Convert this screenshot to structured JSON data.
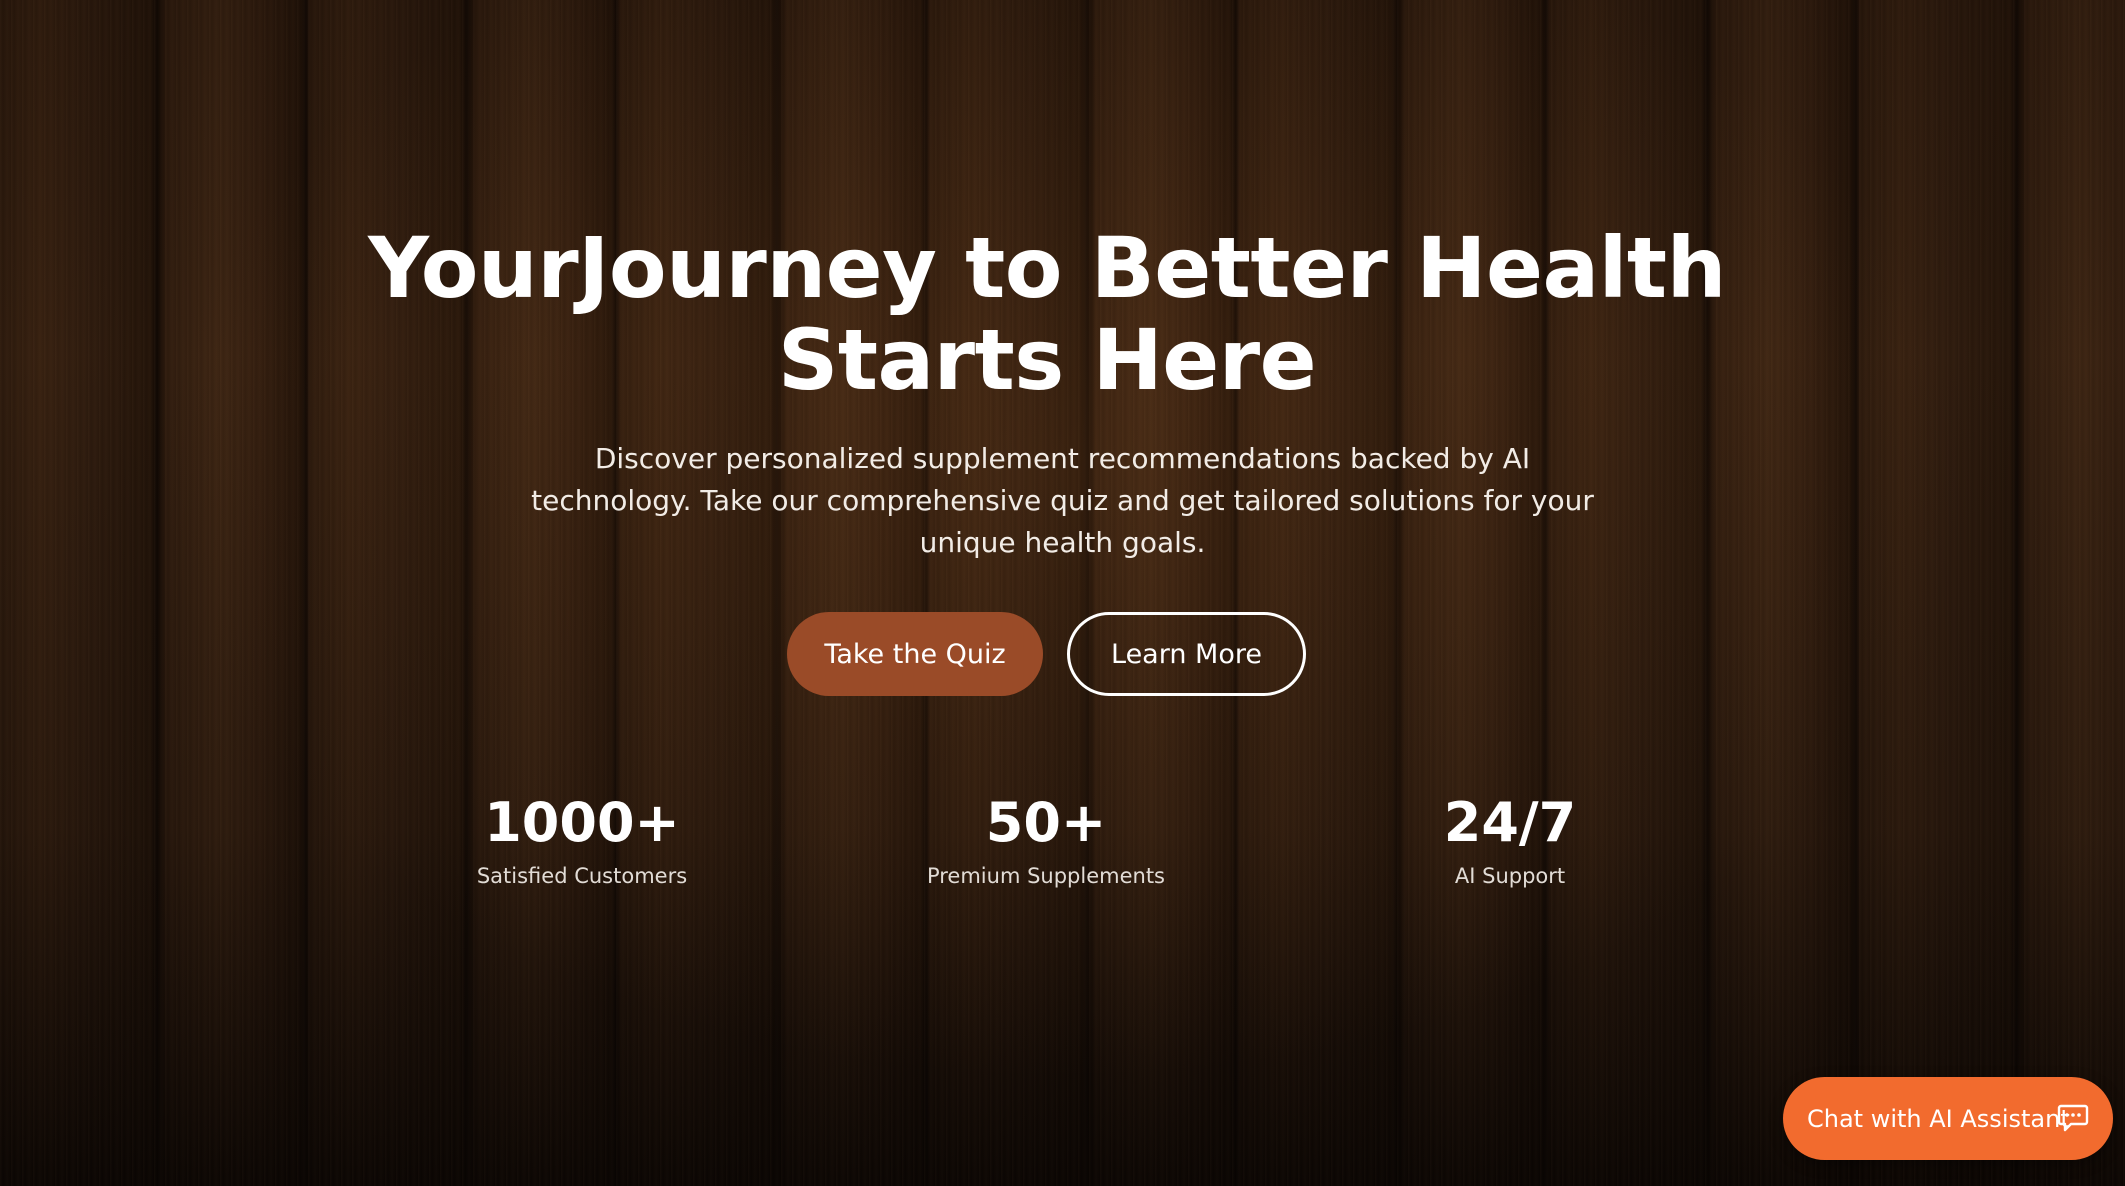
{
  "hero": {
    "headline_line1": "YourJourney to Better Health",
    "headline_line2": "Starts Here",
    "subtitle": "Discover personalized supplement recommendations backed by AI technology. Take our comprehensive quiz and get tailored solutions for your unique health goals."
  },
  "actions": {
    "primary_label": "Take the Quiz",
    "secondary_label": "Learn More"
  },
  "stats": [
    {
      "value": "1000+",
      "label": "Satisfied Customers"
    },
    {
      "value": "50+",
      "label": "Premium Supplements"
    },
    {
      "value": "24/7",
      "label": "AI Support"
    }
  ],
  "chat": {
    "label": "Chat with AI Assistant",
    "icon": "chat-bubble-icon"
  },
  "colors": {
    "primary_button": "#9a4b28",
    "chat_button": "#f26b2e",
    "background": "#3a2312"
  }
}
